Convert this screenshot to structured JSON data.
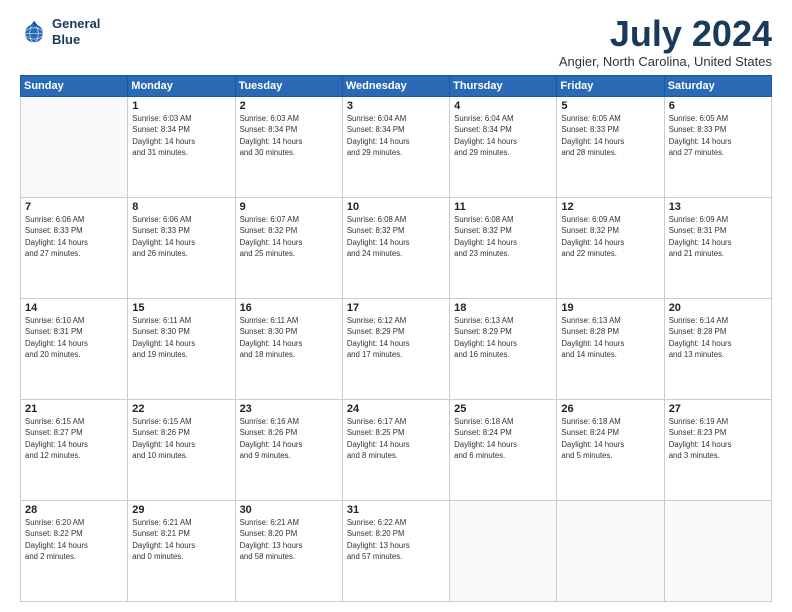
{
  "logo": {
    "line1": "General",
    "line2": "Blue"
  },
  "title": "July 2024",
  "subtitle": "Angier, North Carolina, United States",
  "days_of_week": [
    "Sunday",
    "Monday",
    "Tuesday",
    "Wednesday",
    "Thursday",
    "Friday",
    "Saturday"
  ],
  "weeks": [
    [
      {
        "day": "",
        "info": ""
      },
      {
        "day": "1",
        "info": "Sunrise: 6:03 AM\nSunset: 8:34 PM\nDaylight: 14 hours\nand 31 minutes."
      },
      {
        "day": "2",
        "info": "Sunrise: 6:03 AM\nSunset: 8:34 PM\nDaylight: 14 hours\nand 30 minutes."
      },
      {
        "day": "3",
        "info": "Sunrise: 6:04 AM\nSunset: 8:34 PM\nDaylight: 14 hours\nand 29 minutes."
      },
      {
        "day": "4",
        "info": "Sunrise: 6:04 AM\nSunset: 8:34 PM\nDaylight: 14 hours\nand 29 minutes."
      },
      {
        "day": "5",
        "info": "Sunrise: 6:05 AM\nSunset: 8:33 PM\nDaylight: 14 hours\nand 28 minutes."
      },
      {
        "day": "6",
        "info": "Sunrise: 6:05 AM\nSunset: 8:33 PM\nDaylight: 14 hours\nand 27 minutes."
      }
    ],
    [
      {
        "day": "7",
        "info": "Sunrise: 6:06 AM\nSunset: 8:33 PM\nDaylight: 14 hours\nand 27 minutes."
      },
      {
        "day": "8",
        "info": "Sunrise: 6:06 AM\nSunset: 8:33 PM\nDaylight: 14 hours\nand 26 minutes."
      },
      {
        "day": "9",
        "info": "Sunrise: 6:07 AM\nSunset: 8:32 PM\nDaylight: 14 hours\nand 25 minutes."
      },
      {
        "day": "10",
        "info": "Sunrise: 6:08 AM\nSunset: 8:32 PM\nDaylight: 14 hours\nand 24 minutes."
      },
      {
        "day": "11",
        "info": "Sunrise: 6:08 AM\nSunset: 8:32 PM\nDaylight: 14 hours\nand 23 minutes."
      },
      {
        "day": "12",
        "info": "Sunrise: 6:09 AM\nSunset: 8:32 PM\nDaylight: 14 hours\nand 22 minutes."
      },
      {
        "day": "13",
        "info": "Sunrise: 6:09 AM\nSunset: 8:31 PM\nDaylight: 14 hours\nand 21 minutes."
      }
    ],
    [
      {
        "day": "14",
        "info": "Sunrise: 6:10 AM\nSunset: 8:31 PM\nDaylight: 14 hours\nand 20 minutes."
      },
      {
        "day": "15",
        "info": "Sunrise: 6:11 AM\nSunset: 8:30 PM\nDaylight: 14 hours\nand 19 minutes."
      },
      {
        "day": "16",
        "info": "Sunrise: 6:11 AM\nSunset: 8:30 PM\nDaylight: 14 hours\nand 18 minutes."
      },
      {
        "day": "17",
        "info": "Sunrise: 6:12 AM\nSunset: 8:29 PM\nDaylight: 14 hours\nand 17 minutes."
      },
      {
        "day": "18",
        "info": "Sunrise: 6:13 AM\nSunset: 8:29 PM\nDaylight: 14 hours\nand 16 minutes."
      },
      {
        "day": "19",
        "info": "Sunrise: 6:13 AM\nSunset: 8:28 PM\nDaylight: 14 hours\nand 14 minutes."
      },
      {
        "day": "20",
        "info": "Sunrise: 6:14 AM\nSunset: 8:28 PM\nDaylight: 14 hours\nand 13 minutes."
      }
    ],
    [
      {
        "day": "21",
        "info": "Sunrise: 6:15 AM\nSunset: 8:27 PM\nDaylight: 14 hours\nand 12 minutes."
      },
      {
        "day": "22",
        "info": "Sunrise: 6:15 AM\nSunset: 8:26 PM\nDaylight: 14 hours\nand 10 minutes."
      },
      {
        "day": "23",
        "info": "Sunrise: 6:16 AM\nSunset: 8:26 PM\nDaylight: 14 hours\nand 9 minutes."
      },
      {
        "day": "24",
        "info": "Sunrise: 6:17 AM\nSunset: 8:25 PM\nDaylight: 14 hours\nand 8 minutes."
      },
      {
        "day": "25",
        "info": "Sunrise: 6:18 AM\nSunset: 8:24 PM\nDaylight: 14 hours\nand 6 minutes."
      },
      {
        "day": "26",
        "info": "Sunrise: 6:18 AM\nSunset: 8:24 PM\nDaylight: 14 hours\nand 5 minutes."
      },
      {
        "day": "27",
        "info": "Sunrise: 6:19 AM\nSunset: 8:23 PM\nDaylight: 14 hours\nand 3 minutes."
      }
    ],
    [
      {
        "day": "28",
        "info": "Sunrise: 6:20 AM\nSunset: 8:22 PM\nDaylight: 14 hours\nand 2 minutes."
      },
      {
        "day": "29",
        "info": "Sunrise: 6:21 AM\nSunset: 8:21 PM\nDaylight: 14 hours\nand 0 minutes."
      },
      {
        "day": "30",
        "info": "Sunrise: 6:21 AM\nSunset: 8:20 PM\nDaylight: 13 hours\nand 58 minutes."
      },
      {
        "day": "31",
        "info": "Sunrise: 6:22 AM\nSunset: 8:20 PM\nDaylight: 13 hours\nand 57 minutes."
      },
      {
        "day": "",
        "info": ""
      },
      {
        "day": "",
        "info": ""
      },
      {
        "day": "",
        "info": ""
      }
    ]
  ]
}
